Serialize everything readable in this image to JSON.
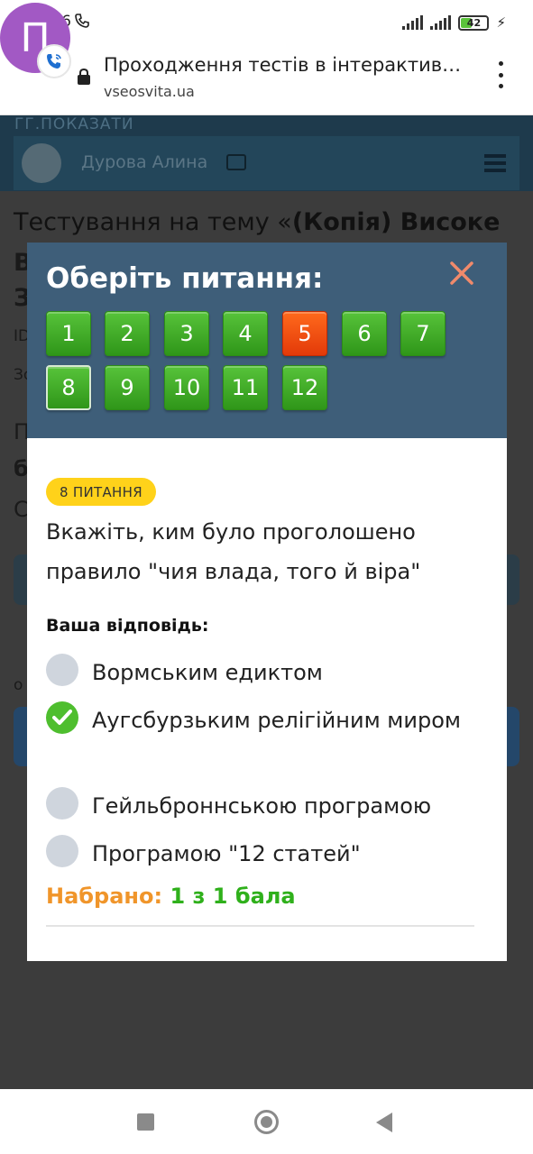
{
  "status_bar": {
    "time": "16:36",
    "battery_level": "42",
    "call_icon": "phone-wifi-icon",
    "charge_icon": "bolt-icon"
  },
  "browser": {
    "avatar_letter": "П",
    "page_title": "Проходження тестів в інтерактивному режимі",
    "url": "vseosvita.ua",
    "lock_icon": "lock-icon",
    "menu_icon": "more-vert-icon"
  },
  "background": {
    "show_label": "ГГ.ПОКАЗАТИ",
    "user_name": "Дурова Алина",
    "test_title_prefix": "Тестування на тему «",
    "test_title_bold": "(Копія) Високе",
    "frag_b": "В",
    "frag_3": "З",
    "frag_id": "ID",
    "frag_zo": "Зо",
    "frag_p": "П",
    "frag_6": "б",
    "frag_c": "С",
    "frag_o": "о"
  },
  "modal": {
    "title": "Оберіть питання:",
    "questions": [
      {
        "label": "1",
        "status": "correct"
      },
      {
        "label": "2",
        "status": "correct"
      },
      {
        "label": "3",
        "status": "correct"
      },
      {
        "label": "4",
        "status": "correct"
      },
      {
        "label": "5",
        "status": "wrong"
      },
      {
        "label": "6",
        "status": "correct"
      },
      {
        "label": "7",
        "status": "correct"
      },
      {
        "label": "8",
        "status": "current"
      },
      {
        "label": "9",
        "status": "correct"
      },
      {
        "label": "10",
        "status": "correct"
      },
      {
        "label": "11",
        "status": "correct"
      },
      {
        "label": "12",
        "status": "correct"
      }
    ],
    "badge": "8 ПИТАННЯ",
    "question_text": "Вкажіть, ким було проголошено правило \"чия влада, того й віра\"",
    "answer_label": "Ваша відповідь:",
    "options": [
      {
        "text": "Вормським едиктом",
        "selected": false
      },
      {
        "text": "Аугсбурзьким релігійним миром",
        "selected": true
      },
      {
        "text": "Гейльброннською програмою",
        "selected": false
      },
      {
        "text": "Програмою \"12 статей\"",
        "selected": false
      }
    ],
    "score_label": "Набрано:",
    "score_value": "1 з 1 бала"
  },
  "colors": {
    "modal_header": "#3e5e79",
    "correct_green": "#3fae26",
    "wrong_orange": "#ee4a0e",
    "badge_yellow": "#ffd21a",
    "score_orange": "#f0952a",
    "score_green": "#2fb01b"
  }
}
